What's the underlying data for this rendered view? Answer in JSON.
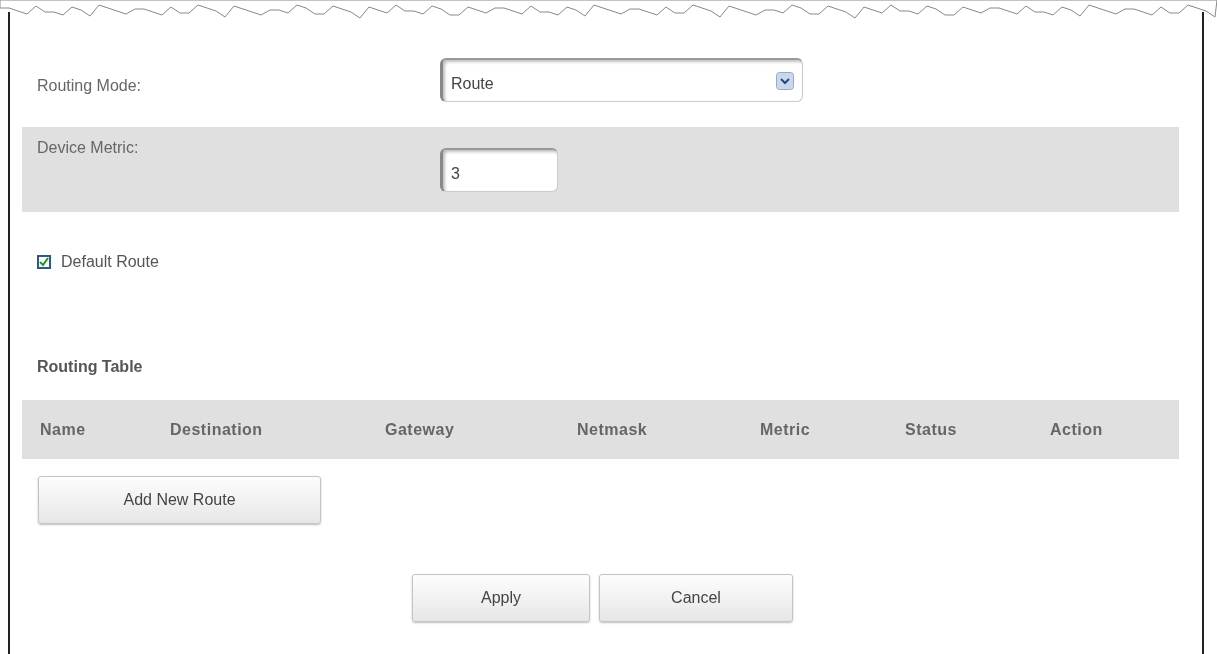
{
  "routing_mode": {
    "label": "Routing Mode:",
    "value": "Route"
  },
  "device_metric": {
    "label": "Device Metric:",
    "value": "3"
  },
  "default_route": {
    "label": "Default Route",
    "checked": true
  },
  "routing_table": {
    "title": "Routing Table",
    "columns": [
      "Name",
      "Destination",
      "Gateway",
      "Netmask",
      "Metric",
      "Status",
      "Action"
    ]
  },
  "add_button": "Add New Route",
  "buttons": [
    "Apply",
    "Cancel"
  ]
}
